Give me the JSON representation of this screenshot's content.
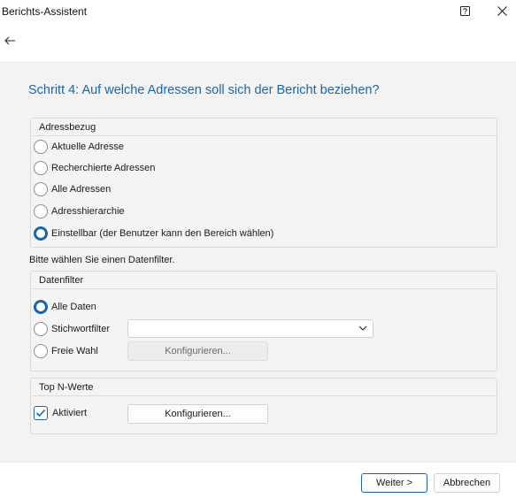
{
  "window": {
    "title": "Berichts-Assistent"
  },
  "step": {
    "title": "Schritt 4: Auf welche Adressen soll sich der Bericht beziehen?"
  },
  "adressbezug": {
    "header": "Adressbezug",
    "selected": "Einstellbar (der Benutzer kann den Bereich wählen)",
    "options": [
      "Aktuelle Adresse",
      "Recherchierte Adressen",
      "Alle Adressen",
      "Adresshierarchie",
      "Einstellbar (der Benutzer kann den Bereich wählen)"
    ]
  },
  "filter_hint": "Bitte wählen Sie einen Datenfilter.",
  "datenfilter": {
    "header": "Datenfilter",
    "selected": "Alle Daten",
    "options": [
      "Alle Daten",
      "Stichwortfilter",
      "Freie Wahl"
    ],
    "combo_value": "",
    "configure_label": "Konfigurieren..."
  },
  "top_n": {
    "header": "Top N-Werte",
    "checkbox_label": "Aktiviert",
    "checked": true,
    "configure_label": "Konfigurieren..."
  },
  "footer": {
    "next_label": "Weiter >",
    "cancel_label": "Abbrechen"
  },
  "colors": {
    "accent": "#1b66a5",
    "content_bg": "#f3f3f3",
    "group_border": "#d8d8d8"
  },
  "icons": {
    "help": "help-icon",
    "close": "close-icon",
    "back": "arrow-left-icon",
    "dropdown": "chevron-down-icon",
    "checkmark": "checkmark-icon"
  }
}
